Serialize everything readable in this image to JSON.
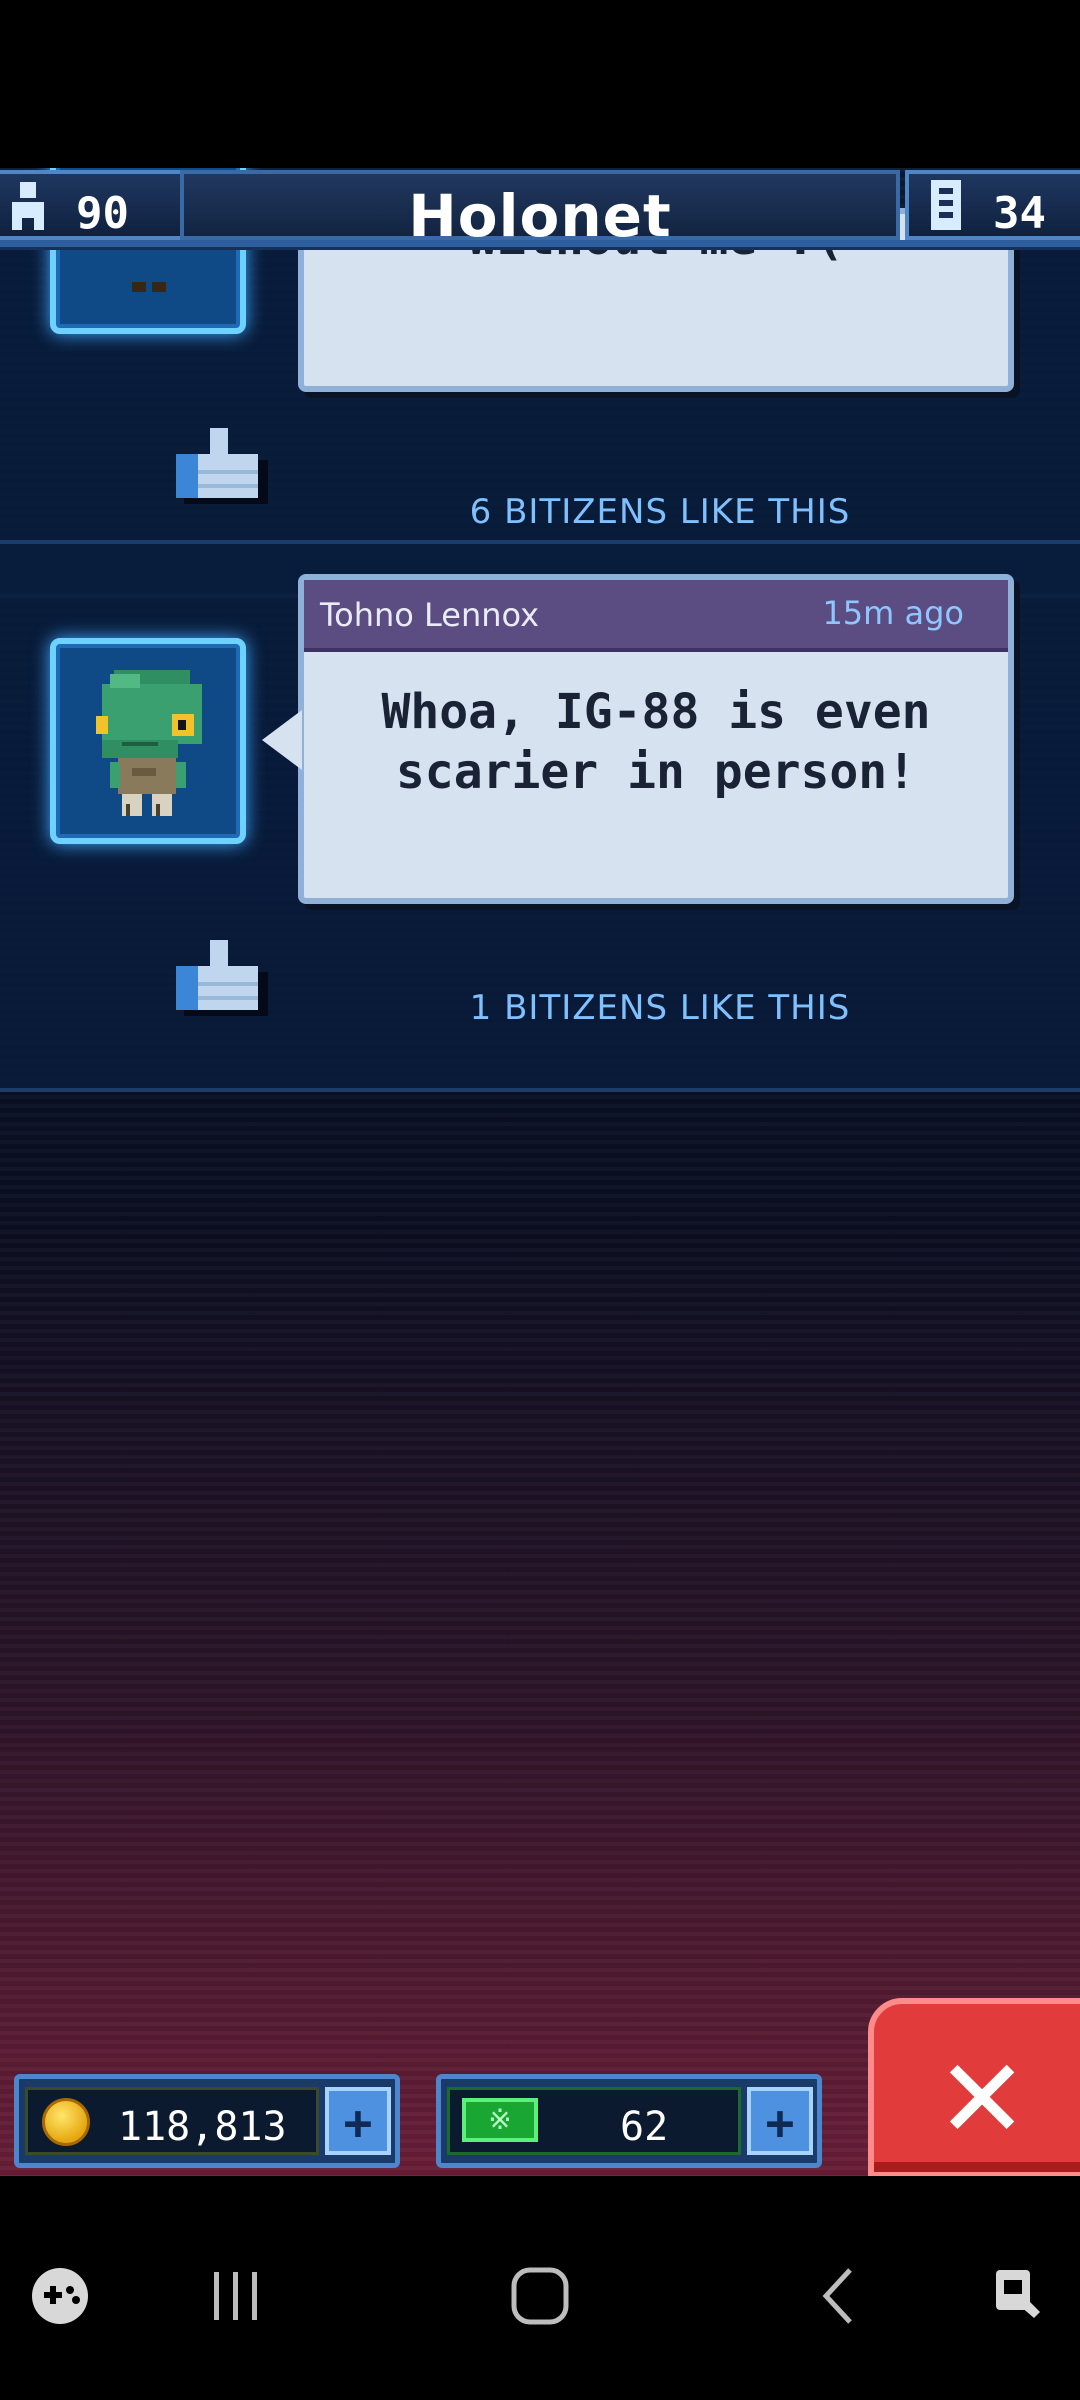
{
  "header": {
    "population": "90",
    "title": "Holonet",
    "floors": "34"
  },
  "posts": [
    {
      "partial_text": "without me :(",
      "likes_label": "6 BITIZENS LIKE THIS"
    },
    {
      "author": "Tohno Lennox",
      "time": "15m ago",
      "message_line1": "Whoa, IG-88 is even",
      "message_line2": "scarier in person!",
      "likes_label": "1 BITIZENS LIKE THIS"
    }
  ],
  "currency": {
    "coins": "118,813",
    "bux": "62",
    "bux_symbol": "※"
  },
  "icons": {
    "population": "person-icon",
    "floors": "floors-icon",
    "like": "thumbs-up-icon",
    "coin": "coin-icon",
    "bux": "bux-icon",
    "add": "plus-icon",
    "close": "close-icon"
  },
  "colors": {
    "accent": "#4f86c8",
    "like_text": "#7fc0ff",
    "bubble_header": "#5b4c82",
    "close_button": "#e23b3b"
  }
}
